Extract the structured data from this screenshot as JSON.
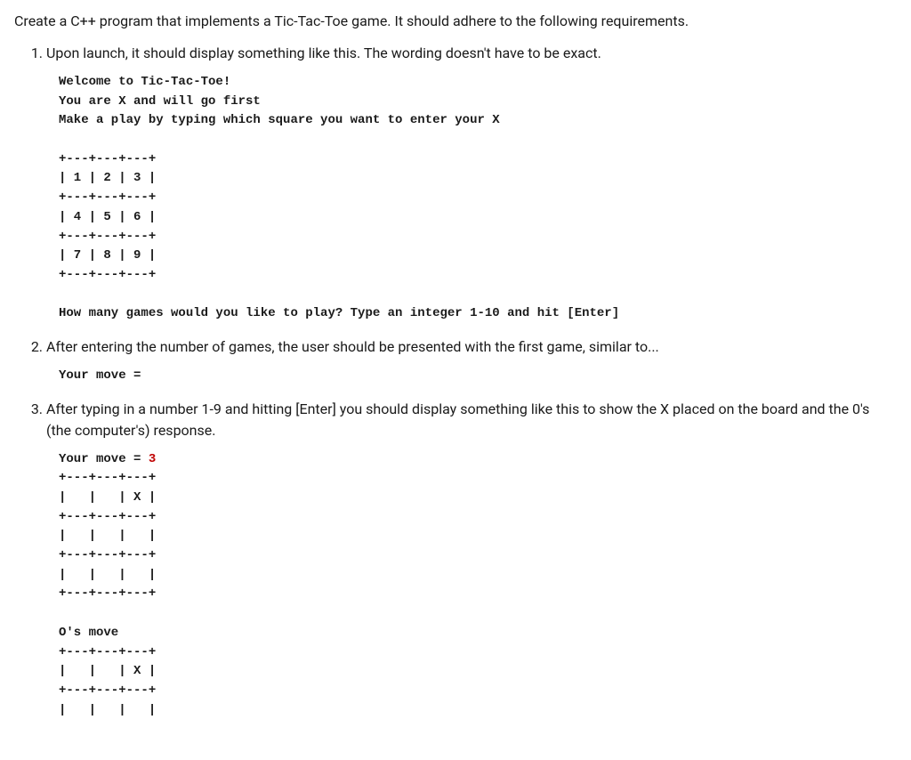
{
  "intro": "Create a C++ program that implements a Tic-Tac-Toe game. It should adhere to the following requirements.",
  "items": [
    {
      "text": "Upon launch, it should display something like this. The wording doesn't have to be exact.",
      "mono": [
        {
          "t": "Welcome to Tic-Tac-Toe!"
        },
        {
          "t": "You are X and will go first"
        },
        {
          "t": "Make a play by typing which square you want to enter your X"
        },
        {
          "t": ""
        },
        {
          "t": "+---+---+---+"
        },
        {
          "t": "| 1 | 2 | 3 |"
        },
        {
          "t": "+---+---+---+"
        },
        {
          "t": "| 4 | 5 | 6 |"
        },
        {
          "t": "+---+---+---+"
        },
        {
          "t": "| 7 | 8 | 9 |"
        },
        {
          "t": "+---+---+---+"
        },
        {
          "t": ""
        },
        {
          "t": "How many games would you like to play? Type an integer 1-10 and hit [Enter]"
        }
      ]
    },
    {
      "text": "After entering the number of games, the user should be presented with the first game, similar to...",
      "mono": [
        {
          "t": "Your move = "
        }
      ]
    },
    {
      "text": "After typing in a number 1-9 and hitting [Enter] you should display something like this to show the X placed on the board and the 0's (the computer's) response.",
      "mono": [
        {
          "segments": [
            {
              "t": "Your move = "
            },
            {
              "t": "3",
              "red": true
            }
          ]
        },
        {
          "t": "+---+---+---+"
        },
        {
          "t": "|   |   | X |"
        },
        {
          "t": "+---+---+---+"
        },
        {
          "t": "|   |   |   |"
        },
        {
          "t": "+---+---+---+"
        },
        {
          "t": "|   |   |   |"
        },
        {
          "t": "+---+---+---+"
        },
        {
          "t": ""
        },
        {
          "t": "O's move"
        },
        {
          "t": "+---+---+---+"
        },
        {
          "t": "|   |   | X |"
        },
        {
          "t": "+---+---+---+"
        },
        {
          "t": "|   |   |   |"
        }
      ]
    }
  ]
}
